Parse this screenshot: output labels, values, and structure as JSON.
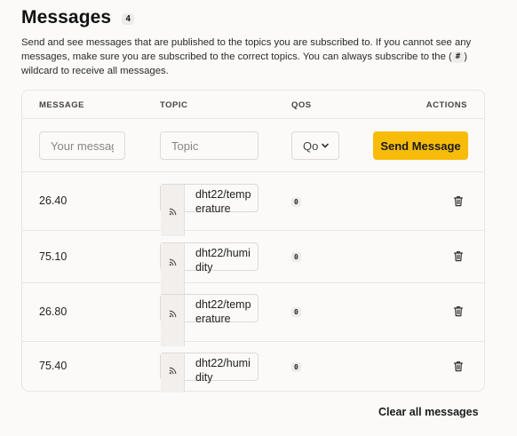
{
  "header": {
    "title": "Messages",
    "count": "4"
  },
  "description": {
    "before": "Send and see messages that are published to the topics you are subscribed to. If you cannot see any messages, make sure you are subscribed to the correct topics. You can always subscribe to the (",
    "wildcard": "#",
    "after": ") wildcard to receive all messages."
  },
  "table": {
    "columns": {
      "message": "MESSAGE",
      "topic": "TOPIC",
      "qos": "QOS",
      "actions": "ACTIONS"
    }
  },
  "compose": {
    "message_placeholder": "Your message",
    "topic_placeholder": "Topic",
    "qos_value": "Qo",
    "send_label": "Send Message"
  },
  "messages": [
    {
      "message": "26.40",
      "topic": "dht22/temperature",
      "qos": "0",
      "icon": "rss-icon",
      "action_icon": "trash-icon"
    },
    {
      "message": "75.10",
      "topic": "dht22/humidity",
      "qos": "0",
      "icon": "rss-icon",
      "action_icon": "trash-icon"
    },
    {
      "message": "26.80",
      "topic": "dht22/temperature",
      "qos": "0",
      "icon": "rss-icon",
      "action_icon": "trash-icon"
    },
    {
      "message": "75.40",
      "topic": "dht22/humidity",
      "qos": "0",
      "icon": "rss-icon",
      "action_icon": "trash-icon"
    }
  ],
  "footer": {
    "clear_label": "Clear all messages"
  },
  "colors": {
    "accent": "#f7bc0a",
    "background": "#fbfaf9",
    "border": "#e9e6e2"
  }
}
